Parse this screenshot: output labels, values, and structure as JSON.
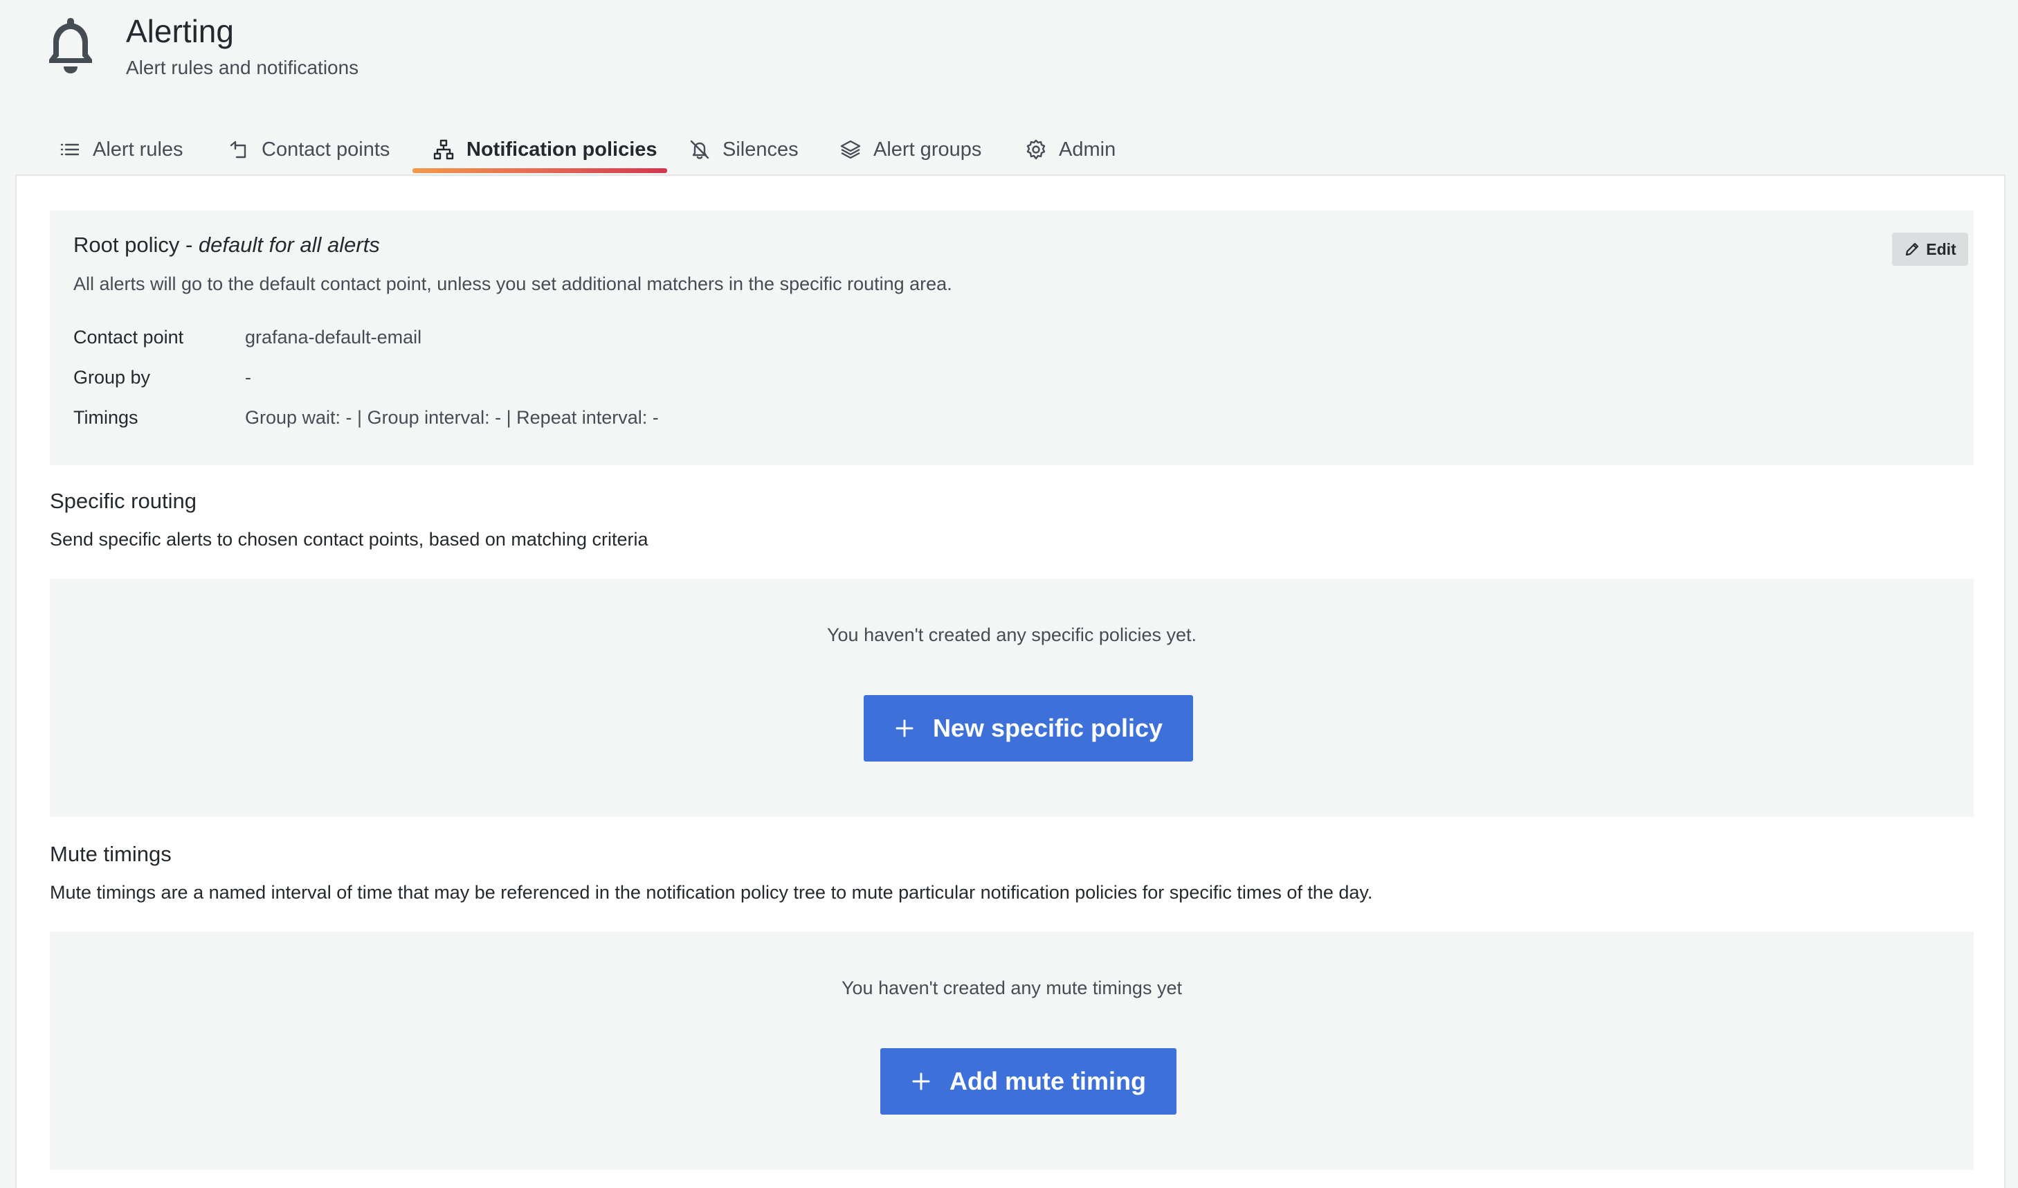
{
  "header": {
    "title": "Alerting",
    "subtitle": "Alert rules and notifications",
    "icon": "bell-icon"
  },
  "tabs": [
    {
      "label": "Alert rules",
      "icon": "list-icon",
      "active": false
    },
    {
      "label": "Contact points",
      "icon": "contact-icon",
      "active": false
    },
    {
      "label": "Notification policies",
      "icon": "sitemap-icon",
      "active": true
    },
    {
      "label": "Silences",
      "icon": "bell-slash-icon",
      "active": false
    },
    {
      "label": "Alert groups",
      "icon": "layers-icon",
      "active": false
    },
    {
      "label": "Admin",
      "icon": "cog-icon",
      "active": false
    }
  ],
  "root_policy": {
    "title_prefix": "Root policy - ",
    "title_emphasis": "default for all alerts",
    "description": "All alerts will go to the default contact point, unless you set additional matchers in the specific routing area.",
    "edit_label": "Edit",
    "rows": [
      {
        "key": "Contact point",
        "value": "grafana-default-email"
      },
      {
        "key": "Group by",
        "value": "-"
      },
      {
        "key": "Timings",
        "value": "Group wait: - | Group interval: - | Repeat interval: -"
      }
    ]
  },
  "specific_routing": {
    "title": "Specific routing",
    "description": "Send specific alerts to chosen contact points, based on matching criteria",
    "empty_text": "You haven't created any specific policies yet.",
    "button_label": "New specific policy"
  },
  "mute_timings": {
    "title": "Mute timings",
    "description": "Mute timings are a named interval of time that may be referenced in the notification policy tree to mute particular notification policies for specific times of the day.",
    "empty_text": "You haven't created any mute timings yet",
    "button_label": "Add mute timing"
  },
  "colors": {
    "primary": "#3d71d9",
    "tab_underline_start": "#f2994a",
    "tab_underline_end": "#d4364e",
    "background": "#f4f5f5",
    "panel": "#ffffff"
  }
}
